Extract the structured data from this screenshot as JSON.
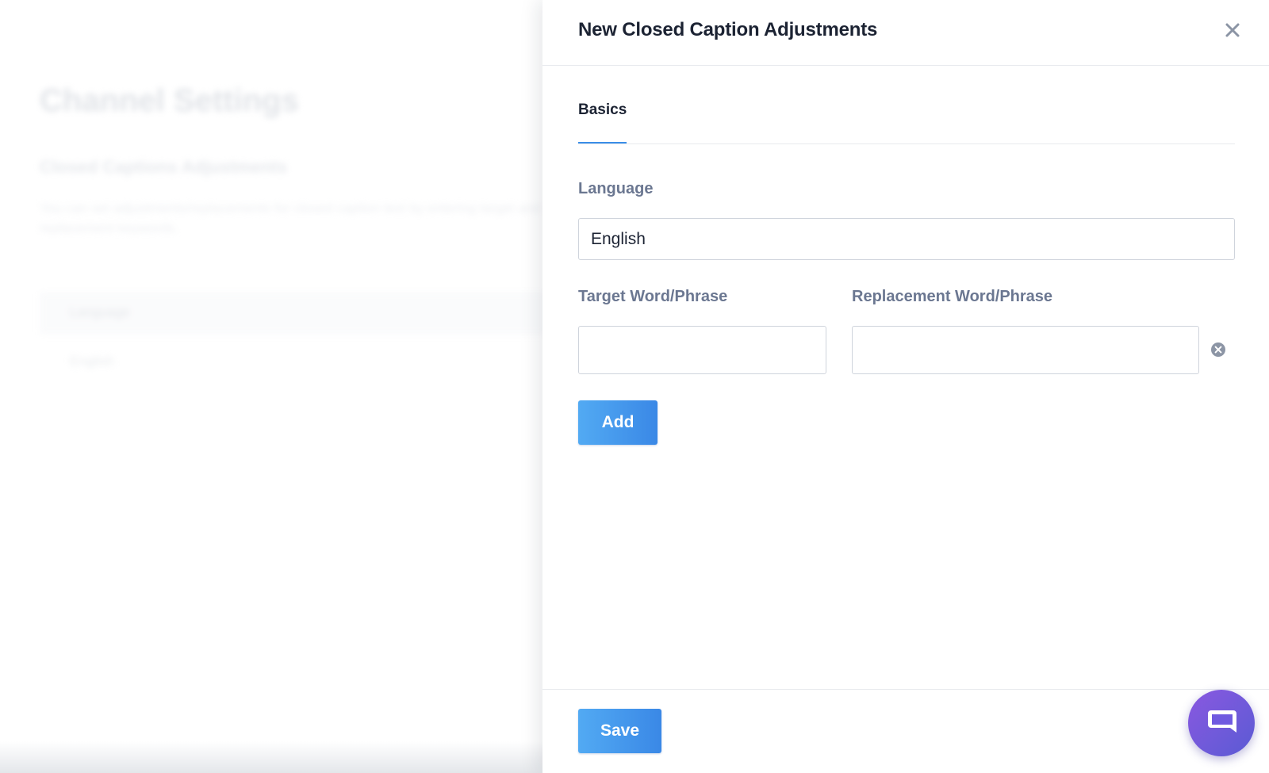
{
  "background": {
    "title": "Channel Settings",
    "subtitle": "Closed Captions Adjustments",
    "description": "You can set adjustments/replacements for closed caption text by entering target and replacement keywords.",
    "table_header": "Language",
    "table_row": "English"
  },
  "drawer": {
    "title": "New Closed Caption Adjustments",
    "tabs": [
      {
        "label": "Basics",
        "active": true
      }
    ],
    "language": {
      "label": "Language",
      "value": "English"
    },
    "target": {
      "label": "Target Word/Phrase",
      "value": ""
    },
    "replacement": {
      "label": "Replacement Word/Phrase",
      "value": ""
    },
    "add_label": "Add",
    "save_label": "Save"
  },
  "icons": {
    "close": "close-icon",
    "remove": "remove-circle-icon",
    "chat": "chat-bubble-icon"
  },
  "colors": {
    "accent": "#3a8ee8",
    "chat_gradient_start": "#8a58e0",
    "chat_gradient_end": "#5a5bd4",
    "label_text": "#6b7791"
  }
}
